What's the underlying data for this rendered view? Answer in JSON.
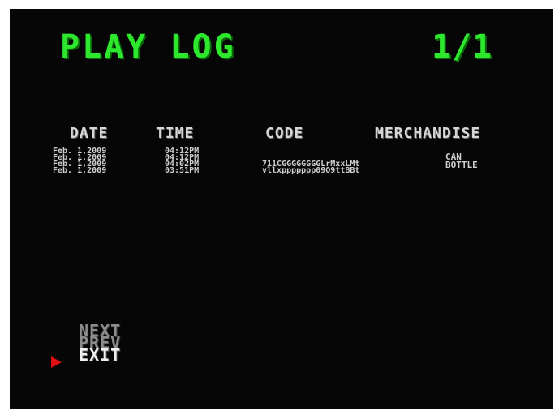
{
  "header": {
    "title": "PLAY LOG",
    "page_indicator": "1/1"
  },
  "table": {
    "columns": [
      "DATE",
      "TIME",
      "CODE",
      "MERCHANDISE"
    ],
    "dates": [
      "Feb. 1,2009",
      "Feb. 1,2009",
      "Feb. 1,2009",
      "Feb. 1,2009"
    ],
    "times": [
      "04:12PM",
      "04:12PM",
      "04:02PM",
      "03:51PM"
    ],
    "codes": [
      "711CGGGGGGGGLrMxxLMt",
      "vllxppppppp09Q9ttBBt"
    ],
    "merchandise": [
      "CAN",
      "BOTTLE"
    ]
  },
  "menu": {
    "items": [
      "NEXT",
      "PREV",
      "EXIT"
    ],
    "selected": "EXIT"
  },
  "colors": {
    "title_green": "#2de82d",
    "cursor_red": "#e01010",
    "background": "#060606"
  },
  "icons": {
    "cursor": "red-triangle-pointer"
  }
}
